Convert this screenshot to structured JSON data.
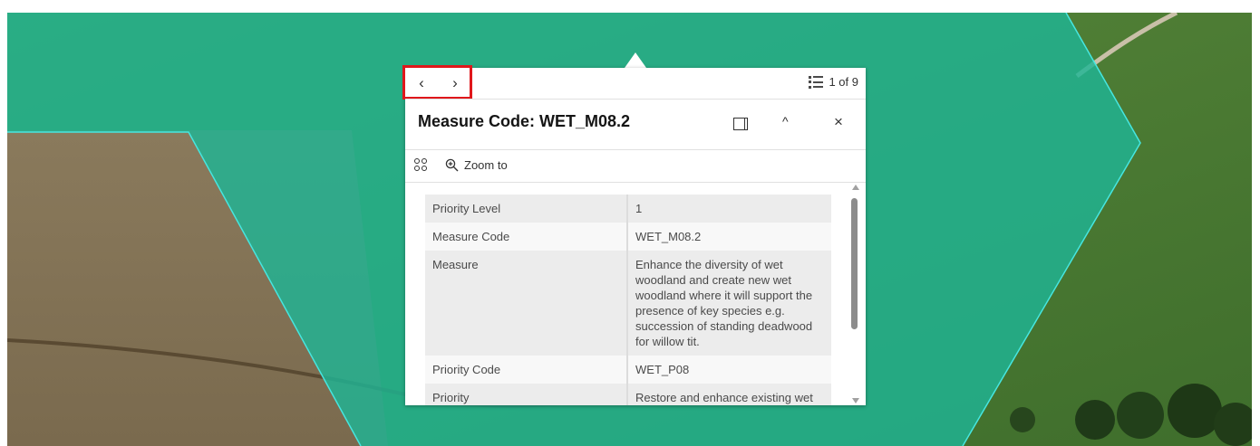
{
  "map": {
    "colors": {
      "field_green": "#4a7a32",
      "field_brown": "#7f6d4f",
      "overlay": "#1fb595",
      "boundary": "#46e6e0"
    }
  },
  "popup": {
    "nav": {
      "prev_label": "‹",
      "next_label": "›"
    },
    "feature_count": "1 of 9",
    "title": "Measure Code: WET_M08.2",
    "collapse_label": "^",
    "close_label": "×",
    "zoom_label": "Zoom to",
    "rows": [
      {
        "key": "Priority Level",
        "value": "1"
      },
      {
        "key": "Measure Code",
        "value": "WET_M08.2"
      },
      {
        "key": "Measure",
        "value": "Enhance the diversity of wet woodland and create new wet woodland where it will support the presence of key species e.g. succession of standing deadwood for willow tit."
      },
      {
        "key": "Priority Code",
        "value": "WET_P08"
      },
      {
        "key": "Priority",
        "value": "Restore and enhance existing wet"
      }
    ],
    "highlight_color": "#e0171b"
  }
}
